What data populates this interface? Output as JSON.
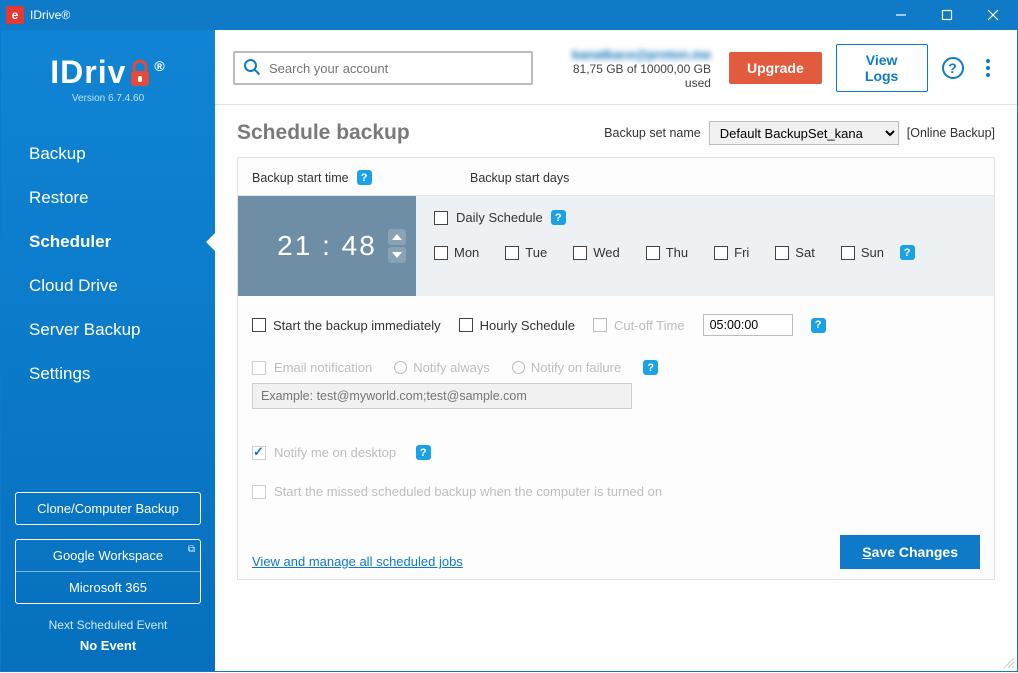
{
  "window": {
    "title": "IDrive®"
  },
  "logo": {
    "brand_1": "IDriv",
    "brand_2": "®",
    "version": "Version  6.7.4.60"
  },
  "sidebar": {
    "items": [
      {
        "label": "Backup"
      },
      {
        "label": "Restore"
      },
      {
        "label": "Scheduler"
      },
      {
        "label": "Cloud Drive"
      },
      {
        "label": "Server Backup"
      },
      {
        "label": "Settings"
      }
    ],
    "clone_btn": "Clone/Computer Backup",
    "ws": {
      "google": "Google Workspace",
      "ms": "Microsoft 365"
    },
    "next_label": "Next Scheduled Event",
    "next_value": "No Event"
  },
  "topbar": {
    "search_placeholder": "Search your account",
    "email": "kanatkace@proton.me",
    "quota": "81,75 GB of 10000,00 GB used",
    "upgrade": "Upgrade",
    "view_logs": "View Logs"
  },
  "page": {
    "title": "Schedule backup",
    "bsn_label": "Backup set name",
    "bsn_value": "Default BackupSet_kana",
    "bsn_type": "[Online Backup]",
    "start_time_label": "Backup start time",
    "start_days_label": "Backup start days",
    "time": "21 : 48",
    "daily_label": "Daily Schedule",
    "days": {
      "mon": "Mon",
      "tue": "Tue",
      "wed": "Wed",
      "thu": "Thu",
      "fri": "Fri",
      "sat": "Sat",
      "sun": "Sun"
    },
    "start_immediately": "Start the backup immediately",
    "hourly": "Hourly Schedule",
    "cutoff_label": "Cut-off Time",
    "cutoff_value": "05:00:00",
    "email_notif": "Email notification",
    "notify_always": "Notify always",
    "notify_failure": "Notify on failure",
    "email_placeholder": "Example: test@myworld.com;test@sample.com",
    "notify_desktop": "Notify me on desktop",
    "start_missed": "Start the missed scheduled backup when the computer is turned on",
    "manage_link": "View and manage all scheduled jobs",
    "save_s": "S",
    "save_rest": "ave Changes"
  }
}
